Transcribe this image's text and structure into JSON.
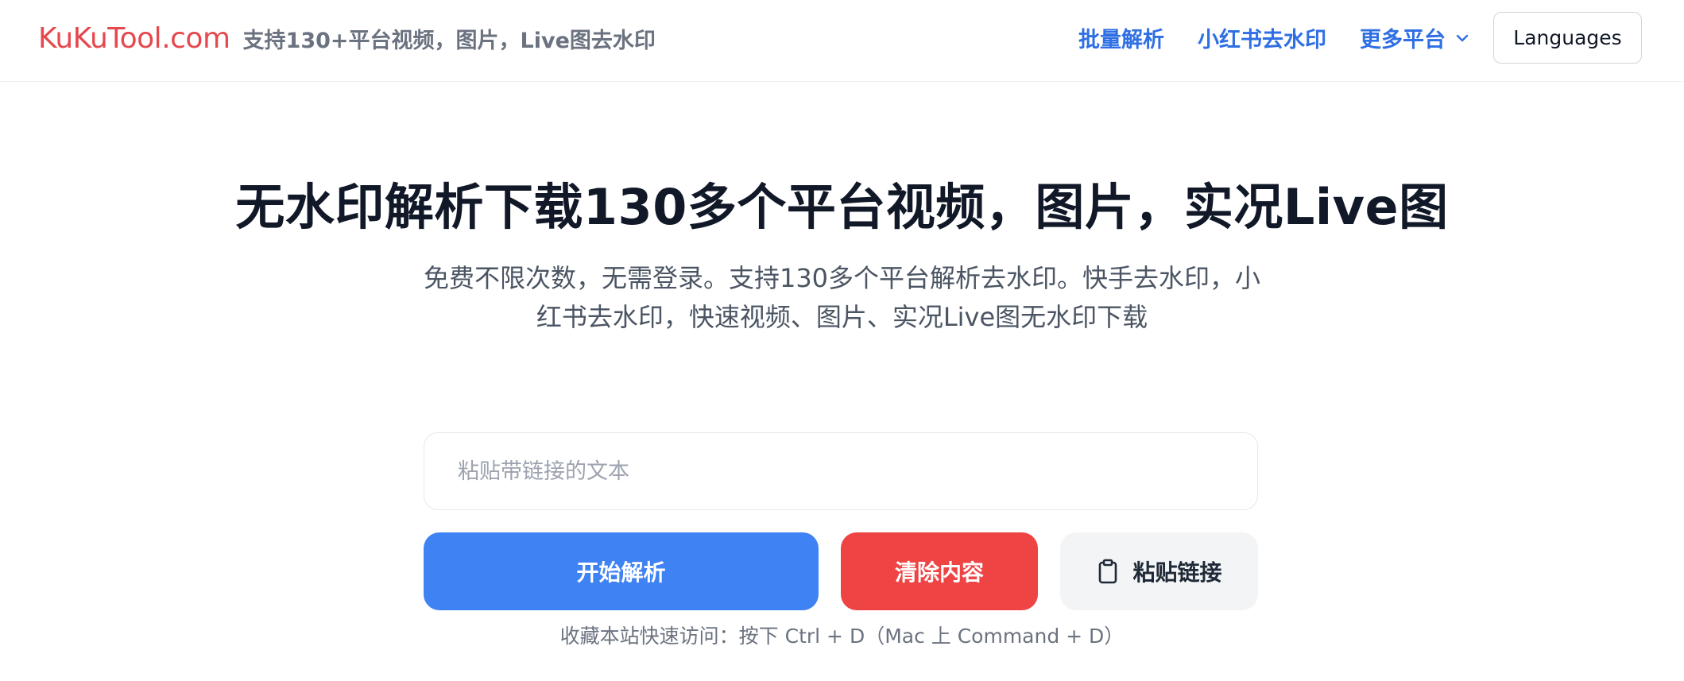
{
  "header": {
    "logo": "KuKuTool.com",
    "tagline": "支持130+平台视频，图片，Live图去水印",
    "nav": {
      "batch_parse": "批量解析",
      "xiaohongshu": "小红书去水印",
      "more_platforms": "更多平台",
      "languages": "Languages"
    }
  },
  "hero": {
    "title": "无水印解析下载130多个平台视频，图片，实况Live图",
    "subtitle": "免费不限次数，无需登录。支持130多个平台解析去水印。快手去水印，小红书去水印，快速视频、图片、实况Live图无水印下载"
  },
  "form": {
    "input_placeholder": "粘贴带链接的文本",
    "input_value": "",
    "parse_button": "开始解析",
    "clear_button": "清除内容",
    "paste_button": "粘贴链接",
    "paste_icon": "clipboard-icon",
    "hint": "收藏本站快速访问：按下 Ctrl + D（Mac 上 Command + D）"
  },
  "colors": {
    "brand_red": "#e5484d",
    "nav_blue": "#2f6fe4",
    "primary_blue": "#3f82f3",
    "danger_red": "#ee4444",
    "neutral_bg": "#f3f4f6"
  }
}
